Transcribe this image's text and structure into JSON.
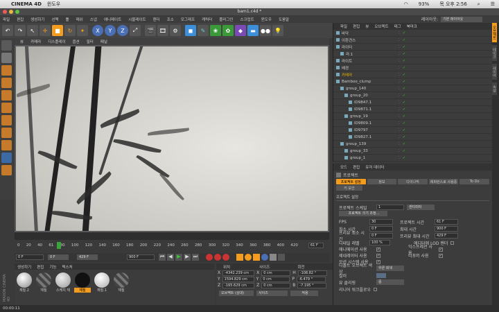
{
  "mac_menu": {
    "app": "CINEMA 4D",
    "window": "윈도우",
    "battery": "93%",
    "clock": "목 오후 2:56"
  },
  "window_title": "bam1.c4d *",
  "layout": {
    "label": "레이아웃:",
    "value": "기본 레이아웃"
  },
  "menu": [
    "파일",
    "편집",
    "생성하기",
    "선택",
    "툴",
    "메쉬",
    "스냅",
    "애니메이트",
    "시뮬레이트",
    "렌더",
    "조소",
    "모그래프",
    "캐릭터",
    "플러그인",
    "스크립트",
    "윈도우",
    "도움말"
  ],
  "viewport_menu": [
    "뷰",
    "카메라",
    "디스플레이",
    "옵션",
    "필터",
    "패널"
  ],
  "timeline_ticks": [
    "0",
    "20",
    "40",
    "61",
    "80",
    "100",
    "120",
    "140",
    "160",
    "180",
    "200",
    "220",
    "240",
    "260",
    "280",
    "300",
    "320",
    "340",
    "360",
    "380",
    "400",
    "420"
  ],
  "timeline_end": "61 F",
  "playback": {
    "start": "0 F",
    "cur": "0 F",
    "range": "429 F",
    "end": "900 F"
  },
  "materials_tabs": [
    "생성하기",
    "편집",
    "기능",
    "텍스처"
  ],
  "materials": [
    {
      "name": "재질.2"
    },
    {
      "name": "재질"
    },
    {
      "name": "스케치 재"
    },
    {
      "name": "재질"
    },
    {
      "name": "재질.1"
    },
    {
      "name": "재질"
    }
  ],
  "coords_headers": [
    "위치",
    "사이즈",
    "회전"
  ],
  "coords_rows": [
    {
      "a": "X",
      "pos": "-4342.239 cm",
      "b": "X",
      "size": "0 cm",
      "c": "H",
      "rot": "-108.82 °"
    },
    {
      "a": "Y",
      "pos": "1594.829 cm",
      "b": "Y",
      "size": "0 cm",
      "c": "P",
      "rot": "-6.479 °"
    },
    {
      "a": "Z",
      "pos": "-165.629 cm",
      "b": "Z",
      "size": "0 cm",
      "c": "B",
      "rot": "-7.195 °"
    }
  ],
  "coords_mode": "오브젝트 (상대)",
  "coords_size": "사이즈",
  "apply": "적용",
  "status": "00:00:11",
  "obj_tabs": [
    "파일",
    "편집",
    "뷰",
    "오브젝트",
    "태그",
    "북마크"
  ],
  "objects": [
    {
      "name": "바닥",
      "indent": 0,
      "color": "#ccc"
    },
    {
      "name": "이환견스",
      "indent": 0,
      "color": "#ccc"
    },
    {
      "name": "라이터",
      "indent": 0,
      "color": "#ccc"
    },
    {
      "name": "라.1",
      "indent": 1,
      "color": "#ccc"
    },
    {
      "name": "라이트",
      "indent": 0,
      "color": "#ccc"
    },
    {
      "name": "배경",
      "indent": 0,
      "color": "#ccc"
    },
    {
      "name": "카메라",
      "indent": 0,
      "color": "#e6b400"
    },
    {
      "name": "Bamboo_clump",
      "indent": 0,
      "color": "#ccc"
    },
    {
      "name": "group_140",
      "indent": 1,
      "color": "#ccc"
    },
    {
      "name": "group_20",
      "indent": 2,
      "color": "#ccc"
    },
    {
      "name": "ID9847.1",
      "indent": 3,
      "color": "#ccc"
    },
    {
      "name": "ID9871.1",
      "indent": 3,
      "color": "#ccc"
    },
    {
      "name": "group_19",
      "indent": 2,
      "color": "#ccc"
    },
    {
      "name": "ID9809.1",
      "indent": 3,
      "color": "#ccc"
    },
    {
      "name": "ID9797",
      "indent": 3,
      "color": "#ccc"
    },
    {
      "name": "ID9827.1",
      "indent": 3,
      "color": "#ccc"
    },
    {
      "name": "group_139",
      "indent": 1,
      "color": "#ccc"
    },
    {
      "name": "group_33",
      "indent": 2,
      "color": "#ccc"
    },
    {
      "name": "group_1",
      "indent": 2,
      "color": "#ccc"
    }
  ],
  "attr_tabs": [
    "모드",
    "편집",
    "유저 데이터"
  ],
  "attr_title": "프로젝트",
  "attr_subtabs": [
    "프로젝트 설정",
    "정보",
    "다이나믹",
    "레퍼런스로 사용중",
    "To Do"
  ],
  "attr_subtab2": "키 보간",
  "attr_section": "프로젝트 설정",
  "project_scale": {
    "label": "프로젝트 스케일",
    "value": "1",
    "unit": "센티미터"
  },
  "scale_button": "프로젝트 크기 조정...",
  "fields": [
    {
      "l": "FPS",
      "v": "30",
      "l2": "프로젝트 시간",
      "v2": "61 F"
    },
    {
      "l": "최소 시간",
      "v": "0 F",
      "l2": "최대 시간",
      "v2": "900 F"
    },
    {
      "l": "프리뷰 최소 시간",
      "v": "0 F",
      "l2": "프리뷰 최대 시간",
      "v2": "429 F"
    }
  ],
  "detail": {
    "label": "디테일 레벨",
    "value": "100 %",
    "label2": "에디터에 LOD 렌더"
  },
  "checks": [
    {
      "l": "애니메이션 사용",
      "l2": "익스프레션 사용"
    },
    {
      "l": "제네레이터 사용",
      "l2": "디포머 사용"
    },
    {
      "l": "모션 시스템 사용",
      "l2": ""
    }
  ],
  "default_color": {
    "label": "디폴트 오브젝트 색상",
    "value": "우른 회색"
  },
  "color_label": "컬러",
  "view_clip": {
    "label": "뷰 클리핑",
    "value": "중"
  },
  "linear": "리니어 워크플로우",
  "right_tabs": [
    "오브젝트",
    "테이크",
    "레이어",
    "속성"
  ]
}
